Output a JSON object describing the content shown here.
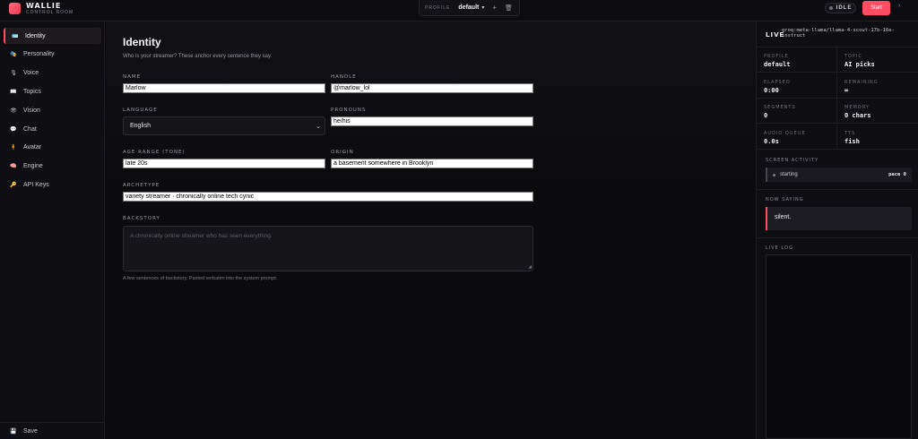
{
  "app": {
    "name": "WALLIE",
    "subtitle": "CONTROL ROOM"
  },
  "profile_bar": {
    "label": "PROFILE",
    "value": "default",
    "add": "+",
    "delete": "🗑"
  },
  "status": {
    "text": "IDLE",
    "start_label": "Start",
    "more": "›"
  },
  "sidebar": {
    "items": [
      {
        "label": "Identity",
        "icon": "id-card-icon",
        "glyph": "🪪",
        "active": true
      },
      {
        "label": "Personality",
        "icon": "theater-icon",
        "glyph": "🎭",
        "active": false
      },
      {
        "label": "Voice",
        "icon": "microphone-icon",
        "glyph": "🎙",
        "active": false
      },
      {
        "label": "Topics",
        "icon": "book-icon",
        "glyph": "📖",
        "active": false
      },
      {
        "label": "Vision",
        "icon": "eye-icon",
        "glyph": "👁",
        "active": false
      },
      {
        "label": "Chat",
        "icon": "speech-bubble-icon",
        "glyph": "💬",
        "active": false
      },
      {
        "label": "Avatar",
        "icon": "avatar-icon",
        "glyph": "🧍",
        "active": false
      },
      {
        "label": "Engine",
        "icon": "brain-icon",
        "glyph": "🧠",
        "active": false
      },
      {
        "label": "API Keys",
        "icon": "key-icon",
        "glyph": "🔑",
        "active": false
      }
    ],
    "save_label": "Save",
    "save_glyph": "💾"
  },
  "main": {
    "title": "Identity",
    "subtitle": "Who is your streamer? These anchor every sentence they say.",
    "fields": {
      "name": {
        "label": "NAME",
        "value": "Marlow"
      },
      "handle": {
        "label": "HANDLE",
        "value": "@marlow_lol"
      },
      "language": {
        "label": "LANGUAGE",
        "value": "English"
      },
      "pronouns": {
        "label": "PRONOUNS",
        "value": "he/his"
      },
      "age_range": {
        "label": "AGE RANGE (TONE)",
        "value": "late 20s"
      },
      "origin": {
        "label": "ORIGIN",
        "value": "a basement somewhere in Brooklyn"
      },
      "archetype": {
        "label": "ARCHETYPE",
        "value": "variety streamer · chronically online tech cynic"
      },
      "backstory": {
        "label": "BACKSTORY",
        "placeholder": "A chronically online streamer who has seen everything.",
        "helper": "A few sentences of backstory. Pasted verbatim into the system prompt."
      }
    }
  },
  "live": {
    "label": "LIVE",
    "model": "groq:meta-llama/llama-4-scout-17b-16e-instruct",
    "stats": [
      {
        "label": "PROFILE",
        "value": "default"
      },
      {
        "label": "TOPIC",
        "value": "AI picks"
      },
      {
        "label": "ELAPSED",
        "value": "0:00"
      },
      {
        "label": "REMAINING",
        "value": "∞"
      },
      {
        "label": "SEGMENTS",
        "value": "0"
      },
      {
        "label": "MEMORY",
        "value": "0 chars"
      },
      {
        "label": "AUDIO QUEUE",
        "value": "0.0s"
      },
      {
        "label": "TTS",
        "value": "fish"
      }
    ],
    "screen_activity": {
      "label": "SCREEN ACTIVITY",
      "state": "starting",
      "pace": "pace 0"
    },
    "now_saying": {
      "label": "NOW SAYING",
      "text": "silent."
    },
    "live_log": {
      "label": "LIVE LOG"
    }
  }
}
